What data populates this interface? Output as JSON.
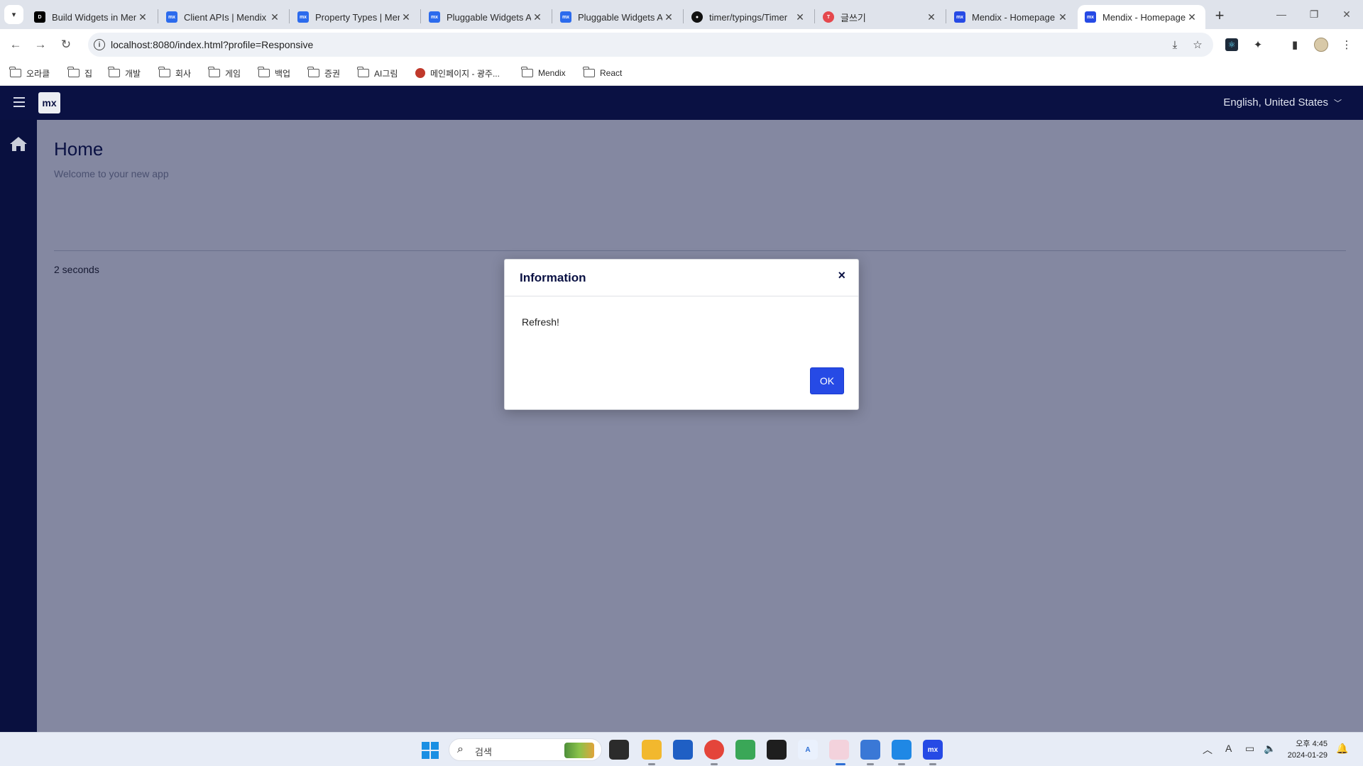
{
  "browser": {
    "tabs": [
      {
        "title": "Build Widgets in Mendix",
        "favicon": "dev-icon",
        "color": "#000000"
      },
      {
        "title": "Client APIs | Mendix",
        "favicon": "mendix-docs-icon",
        "color": "#2c6bed"
      },
      {
        "title": "Property Types | Mendix",
        "favicon": "mendix-docs-icon",
        "color": "#2c6bed"
      },
      {
        "title": "Pluggable Widgets API",
        "favicon": "mendix-docs-icon",
        "color": "#2c6bed"
      },
      {
        "title": "Pluggable Widgets API",
        "favicon": "mendix-docs-icon",
        "color": "#2c6bed"
      },
      {
        "title": "timer/typings/Timer",
        "favicon": "github-icon",
        "color": "#111111"
      },
      {
        "title": "글쓰기",
        "favicon": "tistory-icon",
        "color": "#e5484d"
      },
      {
        "title": "Mendix - Homepage",
        "favicon": "mendix-icon",
        "color": "#264ae5"
      },
      {
        "title": "Mendix - Homepage",
        "favicon": "mendix-icon",
        "color": "#264ae5",
        "active": true
      }
    ],
    "url": "localhost:8080/index.html?profile=Responsive",
    "bookmarks": [
      "오라클",
      "집",
      "개발",
      "회사",
      "게임",
      "백업",
      "증권",
      "AI그림",
      "메인페이지 - 광주...",
      "Mendix",
      "React"
    ]
  },
  "app": {
    "logo": "mx",
    "language": "English, United States",
    "page_title": "Home",
    "page_subtitle": "Welcome to your new app",
    "timer_text": "2 seconds",
    "brand_color": "#0a1143",
    "accent_color": "#264ae5"
  },
  "dialog": {
    "title": "Information",
    "message": "Refresh!",
    "ok_label": "OK",
    "close_label": "×"
  },
  "taskbar": {
    "search_placeholder": "검색",
    "clock_time": "오후 4:45",
    "clock_date": "2024-01-29"
  }
}
